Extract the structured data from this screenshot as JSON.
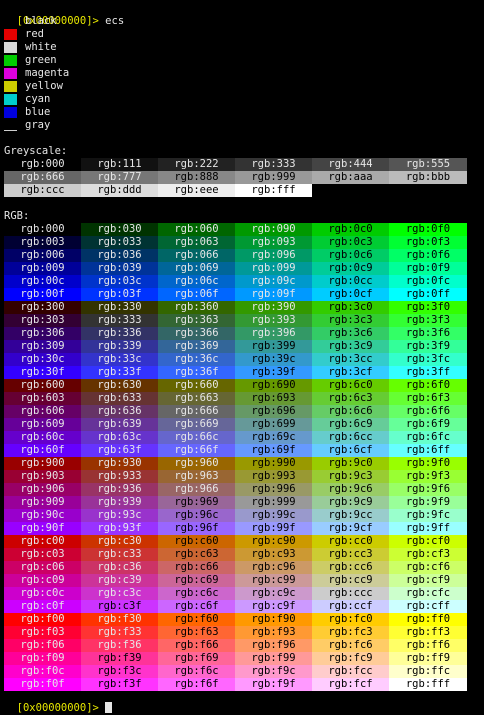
{
  "prompt_top": {
    "text": "[0x00000000]>",
    "command": "ecs"
  },
  "prompt_bottom": {
    "text": "[0x00000000]>"
  },
  "legend": [
    {
      "label": "black",
      "color": "#000000",
      "style": "fill"
    },
    {
      "label": "red",
      "color": "#e60000",
      "style": "fill"
    },
    {
      "label": "white",
      "color": "#d9d9d9",
      "style": "fill"
    },
    {
      "label": "green",
      "color": "#00cc00",
      "style": "fill"
    },
    {
      "label": "magenta",
      "color": "#dd00dd",
      "style": "fill"
    },
    {
      "label": "yellow",
      "color": "#cccc00",
      "style": "fill"
    },
    {
      "label": "cyan",
      "color": "#00cccc",
      "style": "fill"
    },
    {
      "label": "blue",
      "color": "#0000dd",
      "style": "fill"
    },
    {
      "label": "gray",
      "color": "#cfcfcf",
      "style": "underline"
    }
  ],
  "greyscale": {
    "title": "Greyscale:",
    "rows": [
      [
        "rgb:000",
        "rgb:111",
        "rgb:222",
        "rgb:333",
        "rgb:444",
        "rgb:555"
      ],
      [
        "rgb:666",
        "rgb:777",
        "rgb:888",
        "rgb:999",
        "rgb:aaa",
        "rgb:bbb"
      ],
      [
        "rgb:ccc",
        "rgb:ddd",
        "rgb:eee",
        "rgb:fff"
      ]
    ]
  },
  "rgb": {
    "title": "RGB:",
    "r_levels": [
      "0",
      "3",
      "6",
      "9",
      "c",
      "f"
    ],
    "g_levels": [
      "0",
      "3",
      "6",
      "9",
      "c",
      "f"
    ],
    "b_levels": [
      "0",
      "3",
      "6",
      "9",
      "c",
      "f"
    ],
    "label_prefix": "rgb:"
  }
}
